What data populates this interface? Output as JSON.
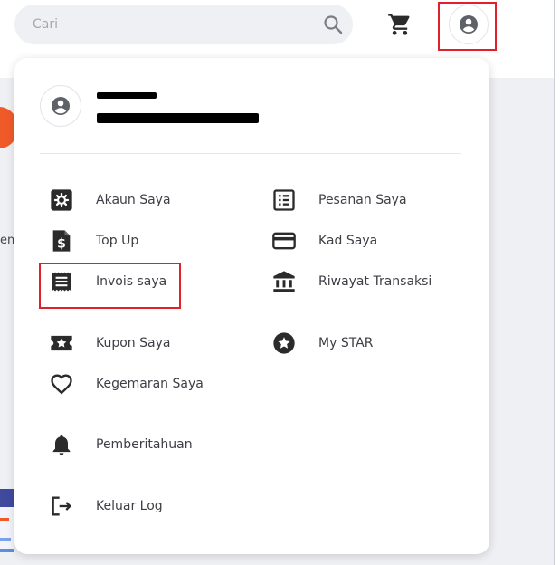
{
  "header": {
    "search": {
      "placeholder": "Cari",
      "value": ""
    }
  },
  "background": {
    "partial_text": "ent"
  },
  "menu": {
    "items_left": [
      {
        "label": "Akaun Saya",
        "icon": "gear-square-icon"
      },
      {
        "label": "Top Up",
        "icon": "dollar-document-icon"
      },
      {
        "label": "Invois saya",
        "icon": "invoice-receipt-icon"
      },
      {
        "label": "Kupon Saya",
        "icon": "coupon-star-icon"
      },
      {
        "label": "Kegemaran Saya",
        "icon": "heart-icon"
      },
      {
        "label": "Pemberitahuan",
        "icon": "bell-icon"
      },
      {
        "label": "Keluar Log",
        "icon": "logout-icon"
      }
    ],
    "items_right": [
      {
        "label": "Pesanan Saya",
        "icon": "list-document-icon"
      },
      {
        "label": "Kad Saya",
        "icon": "credit-card-icon"
      },
      {
        "label": "Riwayat Transaksi",
        "icon": "bank-icon"
      },
      {
        "label": "My STAR",
        "icon": "star-circle-icon"
      }
    ]
  },
  "colors": {
    "highlight_box": "#e0212c",
    "icon": "#2b2b2b",
    "search_bg": "#eff0f4",
    "accent_orange": "#f05a28"
  }
}
